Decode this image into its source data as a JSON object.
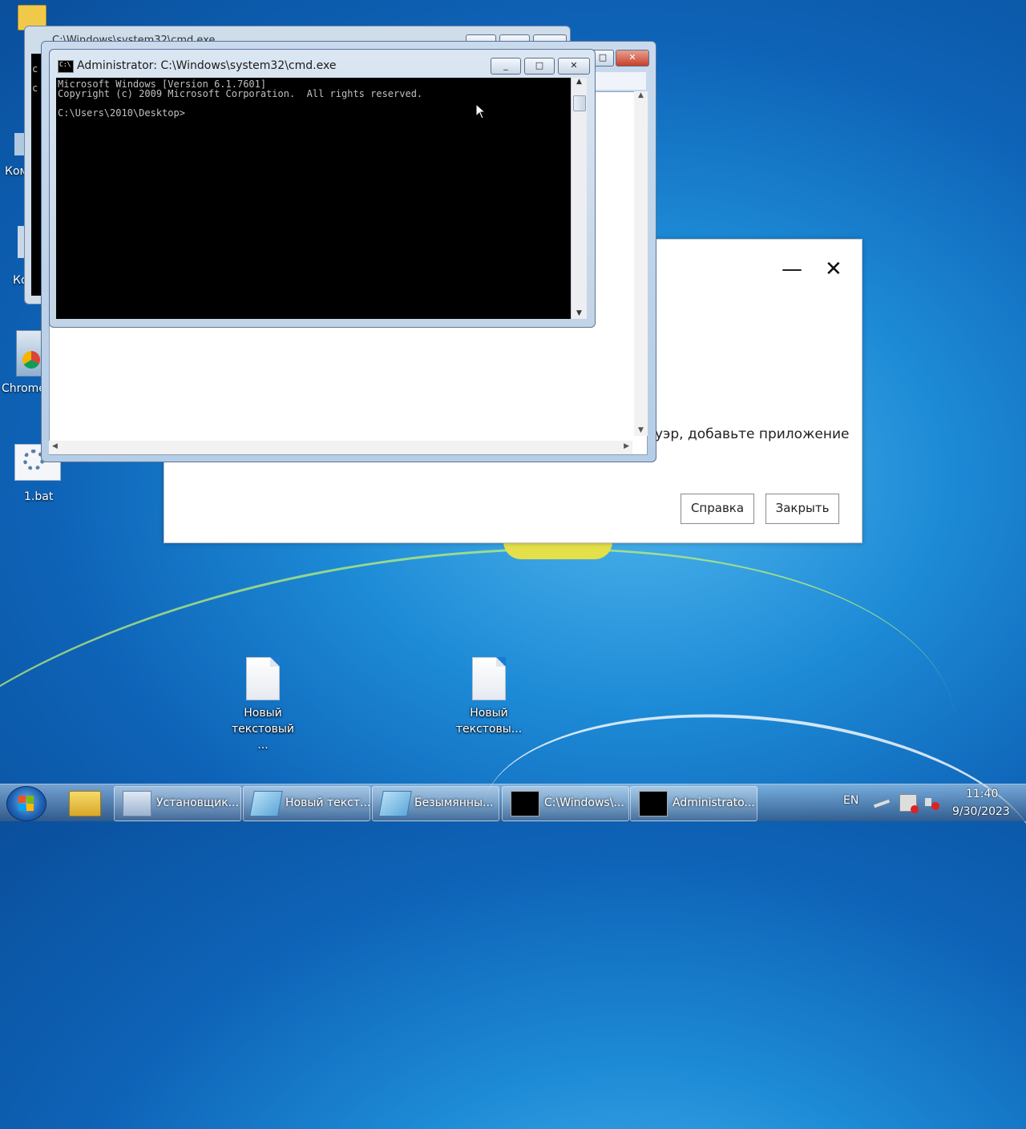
{
  "desktop": {
    "icons": [
      {
        "label": "Ком"
      },
      {
        "label": "Ко"
      },
      {
        "label": "Chrome"
      },
      {
        "label": "1.bat"
      },
      {
        "label": "Новый текстовый ..."
      },
      {
        "label": "Новый текстовы..."
      }
    ]
  },
  "bg_window": {
    "title": "C:\\Windows\\system32\\cmd.exe",
    "left_text_1": "c",
    "left_text_2": "c"
  },
  "cmd_window": {
    "title": "Administrator: C:\\Windows\\system32\\cmd.exe",
    "icon_text": "C:\\",
    "console_text": "Microsoft Windows [Version 6.1.7601]\nCopyright (c) 2009 Microsoft Corporation.  All rights reserved.\n\nC:\\Users\\2010\\Desktop>"
  },
  "dialog": {
    "message": "уэр, добавьте приложение",
    "help_button": "Справка",
    "close_button": "Закрыть",
    "minimize_glyph": "—",
    "close_glyph": "✕"
  },
  "taskbar": {
    "buttons": [
      {
        "label": "Установщик..."
      },
      {
        "label": "Новый текст..."
      },
      {
        "label": "Безымянны..."
      },
      {
        "label": "C:\\Windows\\..."
      },
      {
        "label": "Administrato..."
      }
    ],
    "language": "EN",
    "time": "11:40",
    "date": "9/30/2023"
  }
}
